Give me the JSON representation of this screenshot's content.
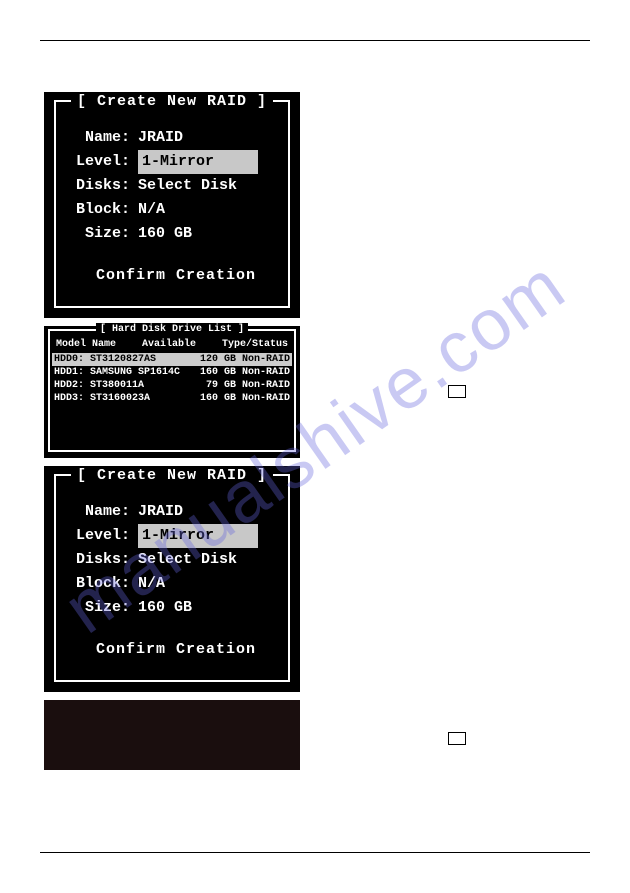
{
  "watermark": "manualshive.com",
  "panel1": {
    "title": "[ Create New RAID ]",
    "name_label": "Name:",
    "name_value": "JRAID",
    "level_label": "Level:",
    "level_value": "1-Mirror",
    "disks_label": "Disks:",
    "disks_value": "Select Disk",
    "block_label": "Block:",
    "block_value": "N/A",
    "size_label": "Size:",
    "size_value": " 160 GB",
    "confirm": "Confirm Creation"
  },
  "hdd": {
    "title": "[ Hard Disk Drive List ]",
    "col_model": "Model Name",
    "col_avail": "Available",
    "col_type": "Type/Status",
    "rows": [
      {
        "id": "HDD0:",
        "model": "ST3120827AS",
        "size": "120 GB",
        "status": "Non-RAID"
      },
      {
        "id": "HDD1:",
        "model": "SAMSUNG SP1614C",
        "size": "160 GB",
        "status": "Non-RAID"
      },
      {
        "id": "HDD2:",
        "model": "ST380011A",
        "size": "79 GB",
        "status": "Non-RAID"
      },
      {
        "id": "HDD3:",
        "model": "ST3160023A",
        "size": "160 GB",
        "status": "Non-RAID"
      }
    ]
  },
  "panel2": {
    "title": "[ Create New RAID ]",
    "name_label": "Name:",
    "name_value": "JRAID",
    "level_label": "Level:",
    "level_value": "1-Mirror",
    "disks_label": "Disks:",
    "disks_value": "Select Disk",
    "block_label": "Block:",
    "block_value": "N/A",
    "size_label": "Size:",
    "size_value": " 160 GB",
    "confirm": "Confirm Creation"
  }
}
